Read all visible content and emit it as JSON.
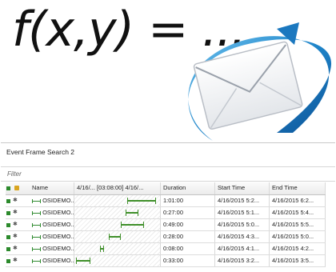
{
  "hero": {
    "formula": "f(x,y) = ..."
  },
  "panel": {
    "title": "Event Frame Search 2",
    "filter_label": "Filter",
    "columns": {
      "name": "Name",
      "timeline": "4/16/...  [03:08:00]  4/16/...",
      "duration": "Duration",
      "start": "Start Time",
      "end": "End Time"
    },
    "rows": [
      {
        "name": "OSIDEMO...",
        "duration": "1:01:00",
        "start": "4/16/2015 5:2...",
        "end": "4/16/2015 6:2...",
        "bar_start": 0.63,
        "bar_end": 0.98
      },
      {
        "name": "OSIDEMO...",
        "duration": "0:27:00",
        "start": "4/16/2015 5:1...",
        "end": "4/16/2015 5:4...",
        "bar_start": 0.61,
        "bar_end": 0.76
      },
      {
        "name": "OSIDEMO...",
        "duration": "0:49:00",
        "start": "4/16/2015 5:0...",
        "end": "4/16/2015 5:5...",
        "bar_start": 0.55,
        "bar_end": 0.83
      },
      {
        "name": "OSIDEMO...",
        "duration": "0:28:00",
        "start": "4/16/2015 4:3...",
        "end": "4/16/2015 5:0...",
        "bar_start": 0.4,
        "bar_end": 0.55
      },
      {
        "name": "OSIDEMO...",
        "duration": "0:08:00",
        "start": "4/16/2015 4:1...",
        "end": "4/16/2015 4:2...",
        "bar_start": 0.29,
        "bar_end": 0.34
      },
      {
        "name": "OSIDEMO...",
        "duration": "0:33:00",
        "start": "4/16/2015 3:2...",
        "end": "4/16/2015 3:5...",
        "bar_start": 0.0,
        "bar_end": 0.18
      }
    ]
  }
}
